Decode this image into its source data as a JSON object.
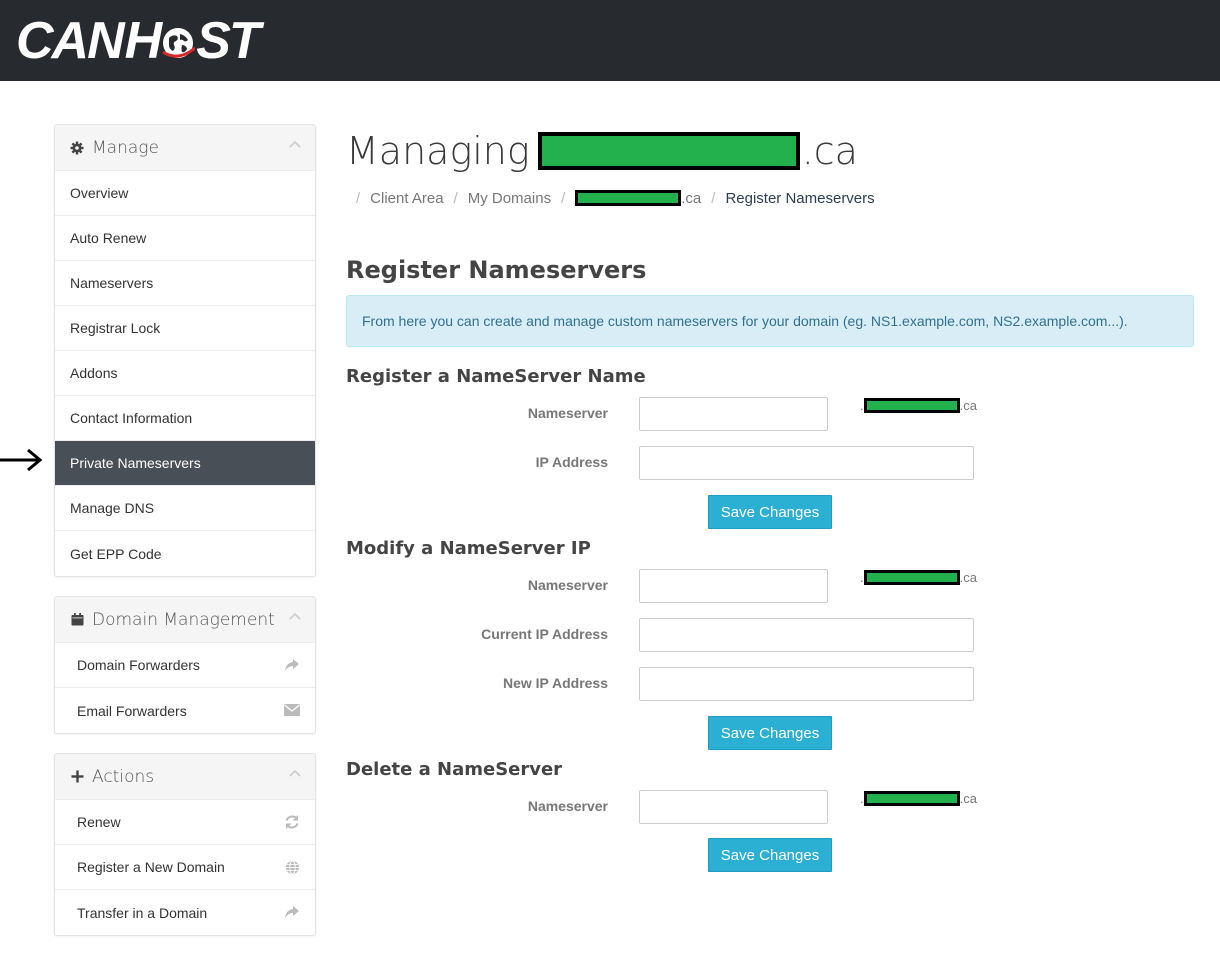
{
  "header": {
    "logo_text_left": "CAN",
    "logo_text_right_a": "H",
    "logo_text_right_b": "ST",
    "bg_color": "#272b30"
  },
  "sidebar": {
    "manage": {
      "title": "Manage",
      "icon": "gear-icon",
      "items": [
        {
          "label": "Overview"
        },
        {
          "label": "Auto Renew"
        },
        {
          "label": "Nameservers"
        },
        {
          "label": "Registrar Lock"
        },
        {
          "label": "Addons"
        },
        {
          "label": "Contact Information"
        },
        {
          "label": "Private Nameservers",
          "active": true
        },
        {
          "label": "Manage DNS"
        },
        {
          "label": "Get EPP Code"
        }
      ]
    },
    "domain_management": {
      "title": "Domain Management",
      "icon": "calendar-icon",
      "items": [
        {
          "label": "Domain Forwarders",
          "icon": "share-icon"
        },
        {
          "label": "Email Forwarders",
          "icon": "envelope-icon"
        }
      ]
    },
    "actions": {
      "title": "Actions",
      "icon": "plus-icon",
      "items": [
        {
          "label": "Renew",
          "icon": "refresh-icon"
        },
        {
          "label": "Register a New Domain",
          "icon": "globe-icon"
        },
        {
          "label": "Transfer in a Domain",
          "icon": "share-icon"
        }
      ]
    }
  },
  "main": {
    "title_prefix": "Managing",
    "title_suffix": ".ca",
    "breadcrumb": {
      "client_area": "Client Area",
      "my_domains": "My Domains",
      "domain_suffix": ".ca",
      "current": "Register Nameservers",
      "sep": "/"
    },
    "section_title": "Register Nameservers",
    "info": "From here you can create and manage custom nameservers for your domain (eg. NS1.example.com, NS2.example.com...).",
    "register": {
      "title": "Register a NameServer Name",
      "nameserver_label": "Nameserver",
      "ip_label": "IP Address",
      "domain_suffix": ".ca",
      "prefix_dot": ".",
      "button": "Save Changes"
    },
    "modify": {
      "title": "Modify a NameServer IP",
      "nameserver_label": "Nameserver",
      "current_ip_label": "Current IP Address",
      "new_ip_label": "New IP Address",
      "domain_suffix": ".ca",
      "prefix_dot": ".",
      "button": "Save Changes"
    },
    "delete": {
      "title": "Delete a NameServer",
      "nameserver_label": "Nameserver",
      "domain_suffix": ".ca",
      "prefix_dot": ".",
      "button": "Save Changes"
    }
  },
  "colors": {
    "accent": "#2bb0d4",
    "active_item": "#484f57",
    "info_bg": "#d9edf7",
    "info_text": "#31708f"
  }
}
